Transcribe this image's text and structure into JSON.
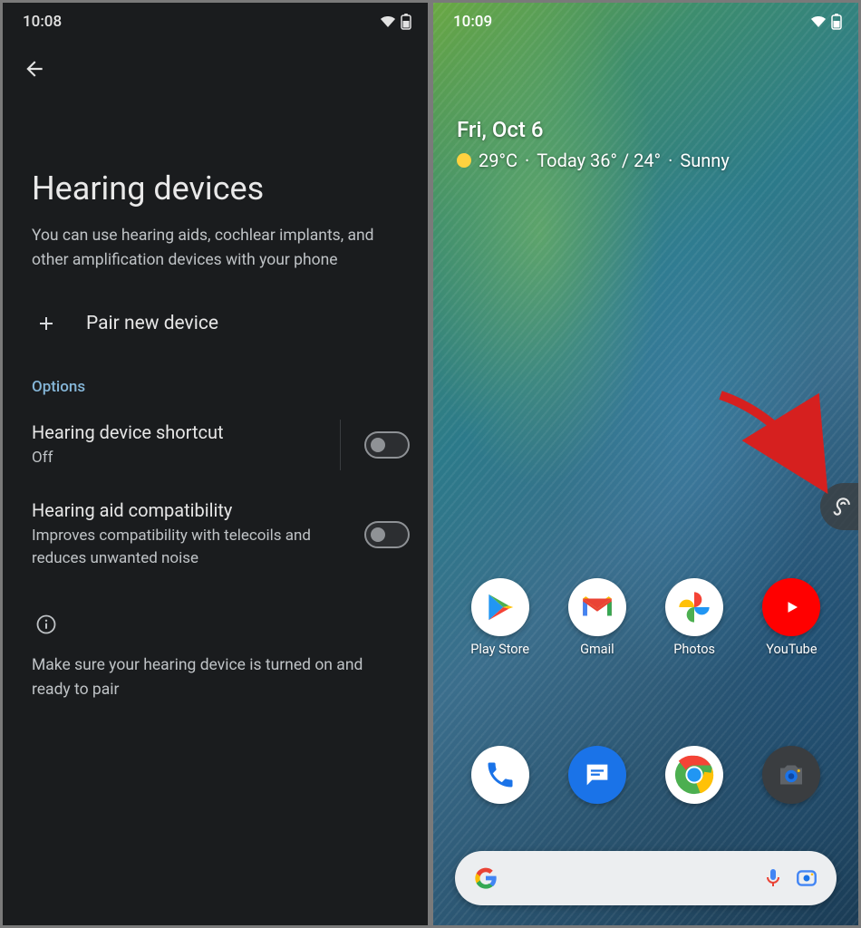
{
  "left": {
    "status": {
      "time": "10:08"
    },
    "title": "Hearing devices",
    "subtitle": "You can use hearing aids, cochlear implants, and other amplification devices with your phone",
    "pair_label": "Pair new device",
    "options_header": "Options",
    "shortcut": {
      "title": "Hearing device shortcut",
      "sub": "Off"
    },
    "compat": {
      "title": "Hearing aid compatibility",
      "sub": "Improves compatibility with telecoils and reduces unwanted noise"
    },
    "info_text": "Make sure your hearing device is turned on and ready to pair"
  },
  "right": {
    "status": {
      "time": "10:09"
    },
    "widget": {
      "date": "Fri, Oct 6",
      "temp": "29°C",
      "forecast": "Today 36° / 24°",
      "condition": "Sunny"
    },
    "apps_row1": [
      {
        "name": "play-store",
        "label": "Play Store"
      },
      {
        "name": "gmail",
        "label": "Gmail"
      },
      {
        "name": "photos",
        "label": "Photos"
      },
      {
        "name": "youtube",
        "label": "YouTube"
      }
    ],
    "dock": [
      {
        "name": "phone"
      },
      {
        "name": "messages"
      },
      {
        "name": "chrome"
      },
      {
        "name": "camera"
      }
    ]
  }
}
